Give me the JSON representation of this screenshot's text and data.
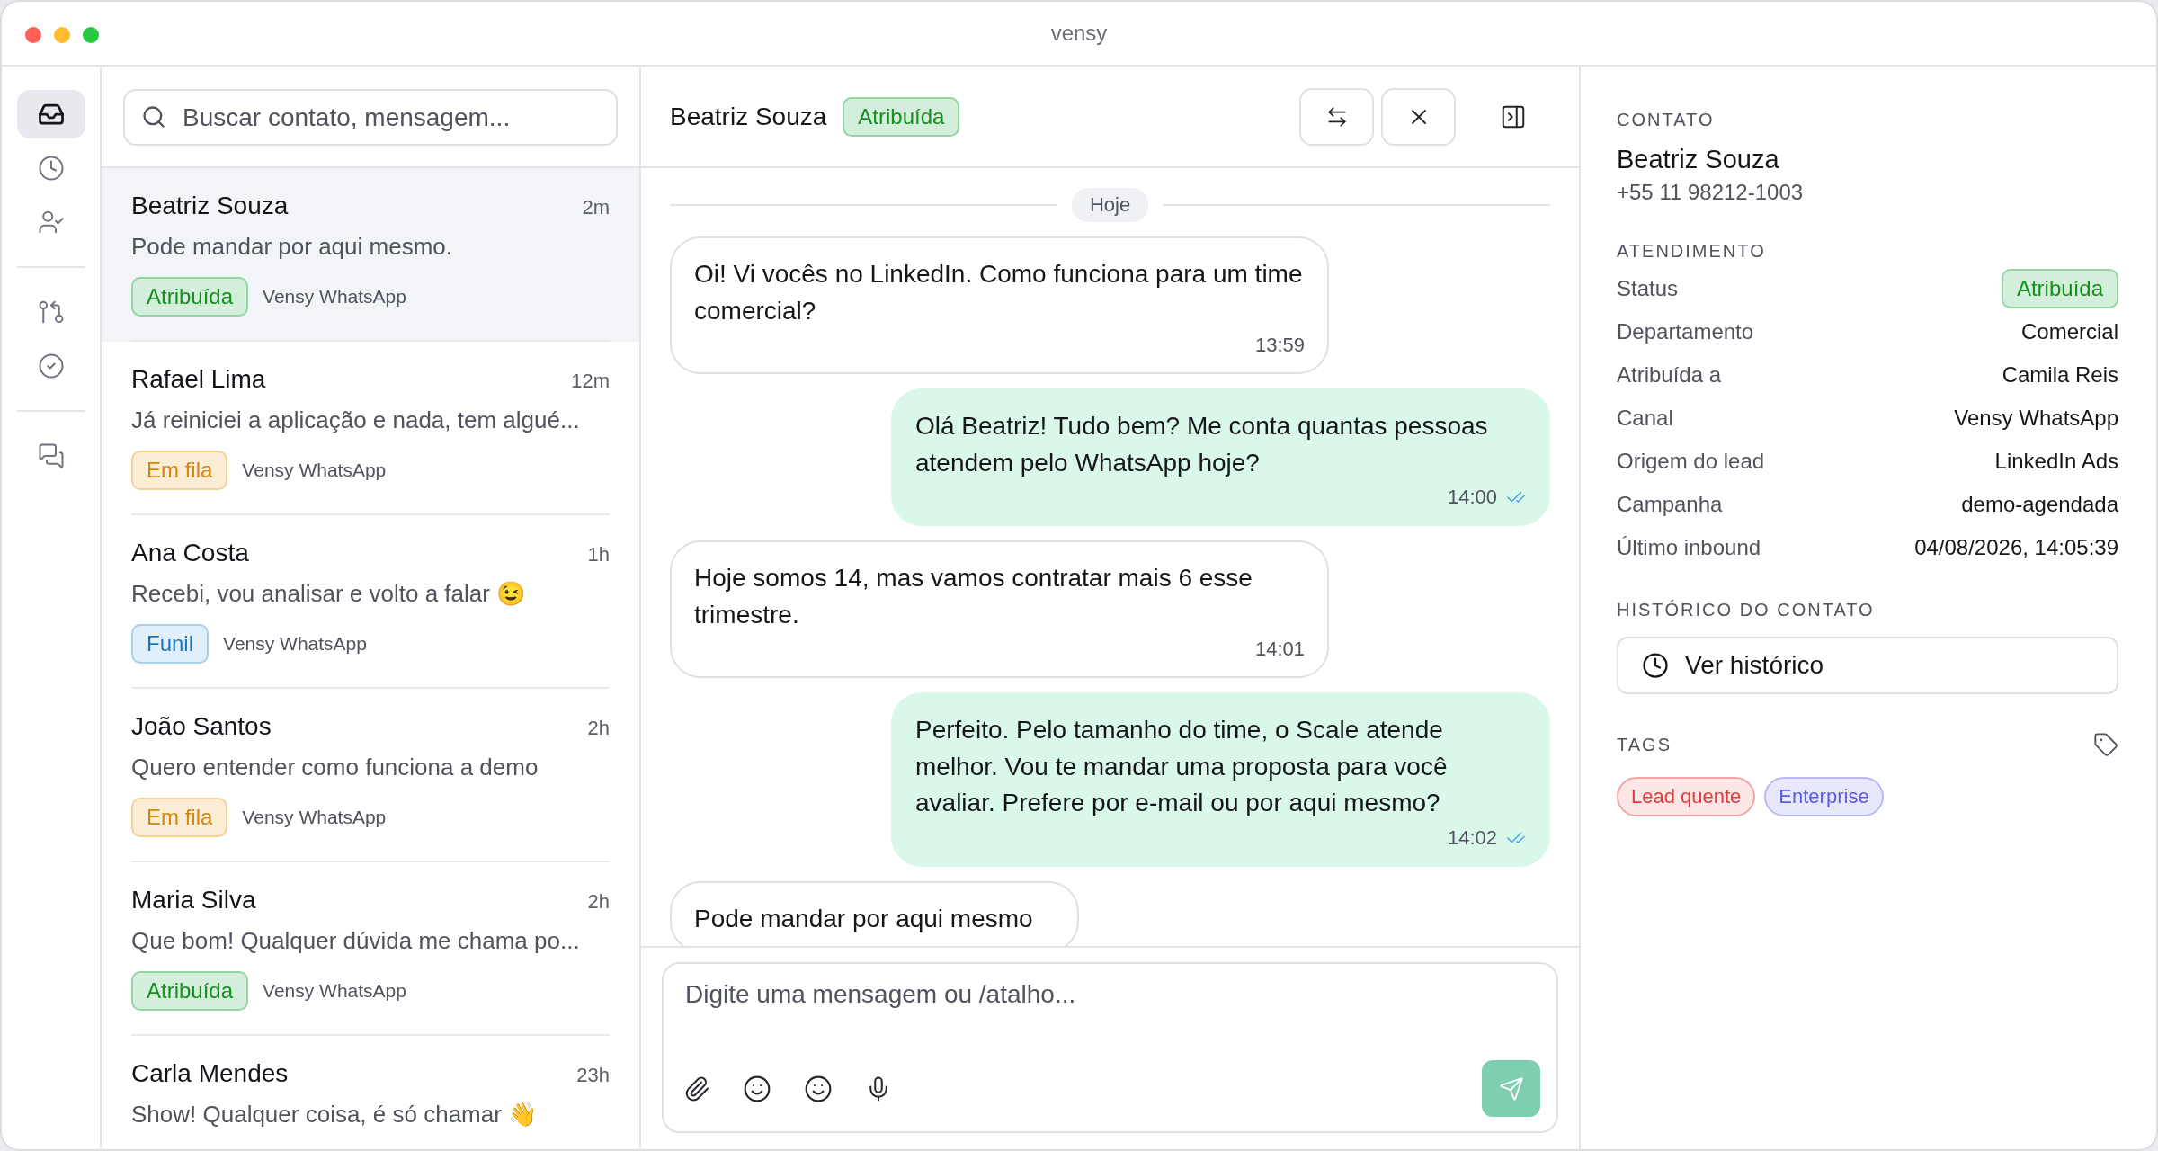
{
  "window": {
    "title": "vensy"
  },
  "rail": [
    [
      {
        "kind": "inbox",
        "selected": true
      },
      {
        "kind": "clock",
        "selected": false
      },
      {
        "kind": "user-check",
        "selected": false
      }
    ],
    [
      {
        "kind": "branch",
        "selected": false
      },
      {
        "kind": "check",
        "selected": false
      }
    ],
    [
      {
        "kind": "chats",
        "selected": false
      }
    ]
  ],
  "search": {
    "placeholder": "Buscar contato, mensagem..."
  },
  "conversations": [
    {
      "name": "Beatriz Souza",
      "time": "2m",
      "preview": "Pode mandar por aqui mesmo.",
      "status": {
        "kind": "assigned",
        "label": "Atribuída"
      },
      "channel": "Vensy WhatsApp",
      "selected": true
    },
    {
      "name": "Rafael Lima",
      "time": "12m",
      "preview": "Já reiniciei a aplicação e nada, tem algué...",
      "status": {
        "kind": "queued",
        "label": "Em fila"
      },
      "channel": "Vensy WhatsApp",
      "selected": false
    },
    {
      "name": "Ana Costa",
      "time": "1h",
      "preview": "Recebi, vou analisar e volto a falar 😉",
      "status": {
        "kind": "funnel",
        "label": "Funil"
      },
      "channel": "Vensy WhatsApp",
      "selected": false
    },
    {
      "name": "João Santos",
      "time": "2h",
      "preview": "Quero entender como funciona a demo",
      "status": {
        "kind": "queued",
        "label": "Em fila"
      },
      "channel": "Vensy WhatsApp",
      "selected": false
    },
    {
      "name": "Maria Silva",
      "time": "2h",
      "preview": "Que bom! Qualquer dúvida me chama po...",
      "status": {
        "kind": "assigned",
        "label": "Atribuída"
      },
      "channel": "Vensy WhatsApp",
      "selected": false
    },
    {
      "name": "Carla Mendes",
      "time": "23h",
      "preview": "Show! Qualquer coisa, é só chamar 👋",
      "selected": false
    }
  ],
  "chat": {
    "contact": "Beatriz Souza",
    "status": {
      "kind": "assigned",
      "label": "Atribuída"
    },
    "day_label": "Hoje",
    "messages": [
      {
        "kind": "in",
        "text": "Oi! Vi vocês no LinkedIn. Como funciona para um time comercial?",
        "time": "13:59"
      },
      {
        "kind": "out",
        "text": "Olá Beatriz! Tudo bem? Me conta quantas pessoas atendem pelo WhatsApp hoje?",
        "time": "14:00",
        "read": true
      },
      {
        "kind": "in",
        "text": "Hoje somos 14, mas vamos contratar mais 6 esse trimestre.",
        "time": "14:01"
      },
      {
        "kind": "out",
        "text": "Perfeito. Pelo tamanho do time, o Scale atende melhor. Vou te mandar uma proposta para você avaliar. Prefere por e-mail ou por aqui mesmo?",
        "time": "14:02",
        "read": true
      },
      {
        "kind": "in",
        "text": "Pode mandar por aqui mesmo"
      }
    ],
    "composer": {
      "placeholder": "Digite uma mensagem ou /atalho..."
    }
  },
  "details": {
    "contact_heading": "CONTATO",
    "name": "Beatriz Souza",
    "phone": "+55 11 98212-1003",
    "service_heading": "ATENDIMENTO",
    "fields": [
      {
        "kind": "badge",
        "label": "Status",
        "status": {
          "kind": "assigned",
          "label": "Atribuída"
        }
      },
      {
        "kind": "text",
        "label": "Departamento",
        "value": "Comercial"
      },
      {
        "kind": "text",
        "label": "Atribuída a",
        "value": "Camila Reis"
      },
      {
        "kind": "text",
        "label": "Canal",
        "value": "Vensy WhatsApp"
      },
      {
        "kind": "text",
        "label": "Origem do lead",
        "value": "LinkedIn Ads"
      },
      {
        "kind": "text",
        "label": "Campanha",
        "value": "demo-agendada"
      },
      {
        "kind": "text",
        "label": "Último inbound",
        "value": "04/08/2026, 14:05:39"
      }
    ],
    "history_heading": "HISTÓRICO DO CONTATO",
    "history_button": "Ver histórico",
    "tags_heading": "TAGS",
    "tags": [
      {
        "label": "Lead quente",
        "kind": "hot"
      },
      {
        "label": "Enterprise",
        "kind": "segment"
      }
    ]
  }
}
